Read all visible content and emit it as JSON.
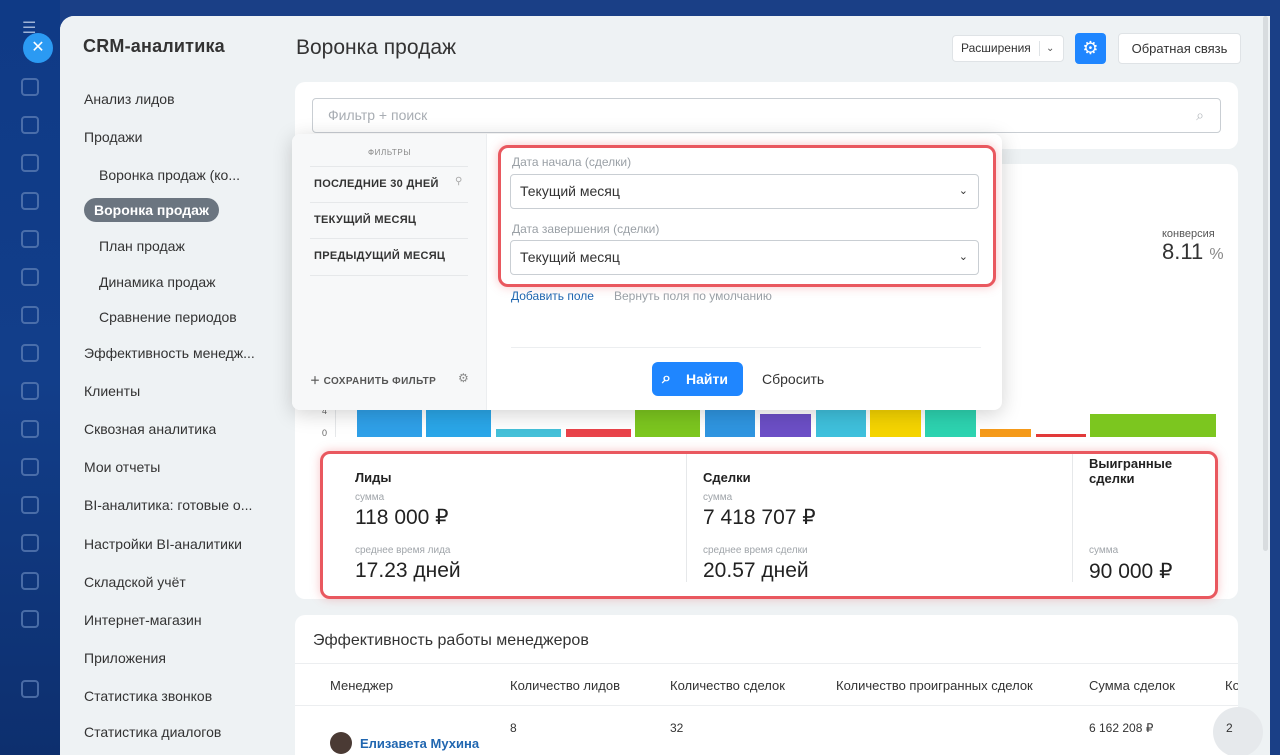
{
  "sidebar": {
    "title": "CRM-аналитика",
    "items": [
      "Анализ лидов",
      "Продажи",
      "Воронка продаж (ко...",
      "Воронка продаж",
      "План продаж",
      "Динамика продаж",
      "Сравнение периодов",
      "Эффективность менедж...",
      "Клиенты",
      "Сквозная аналитика",
      "Мои отчеты",
      "BI-аналитика: готовые о...",
      "Настройки BI-аналитики",
      "Складской учёт",
      "Интернет-магазин",
      "Приложения",
      "Статистика звонков",
      "Статистика диалогов"
    ]
  },
  "header": {
    "title": "Воронка продаж",
    "extensions_label": "Расширения",
    "feedback_label": "Обратная связь"
  },
  "search": {
    "placeholder": "Фильтр + поиск"
  },
  "filter_popup": {
    "caption": "ФИЛЬТРЫ",
    "presets": [
      "ПОСЛЕДНИЕ 30 ДНЕЙ",
      "ТЕКУЩИЙ МЕСЯЦ",
      "ПРЕДЫДУЩИЙ МЕСЯЦ"
    ],
    "save_filter": "СОХРАНИТЬ ФИЛЬТР",
    "field_start_label": "Дата начала (сделки)",
    "field_start_value": "Текущий месяц",
    "field_end_label": "Дата завершения (сделки)",
    "field_end_value": "Текущий месяц",
    "add_field": "Добавить поле",
    "restore_fields": "Вернуть поля по умолчанию",
    "find_button": "Найти",
    "reset_button": "Сбросить"
  },
  "conversion": {
    "label": "конверсия",
    "value": "8.11",
    "unit": "%"
  },
  "chart": {
    "y_axis_ticks": [
      "4",
      "0"
    ]
  },
  "stats": {
    "leads": {
      "title": "Лиды",
      "sum_label": "сумма",
      "sum": "118 000 ₽",
      "time_label": "среднее время лида",
      "time": "17.23 дней"
    },
    "deals": {
      "title": "Сделки",
      "sum_label": "сумма",
      "sum": "7 418 707 ₽",
      "time_label": "среднее время сделки",
      "time": "20.57 дней"
    },
    "won": {
      "title": "Выигранные сделки",
      "sum_label": "сумма",
      "sum": "90 000 ₽"
    }
  },
  "managers": {
    "title": "Эффективность работы менеджеров",
    "columns": [
      "Менеджер",
      "Количество лидов",
      "Количество сделок",
      "Количество проигранных сделок",
      "Сумма сделок",
      "Ко"
    ],
    "rows": [
      {
        "name": "Елизавета Мухина",
        "leads": "8",
        "deals": "32",
        "lost": "",
        "sum": "6 162 208 ₽",
        "extra": "2"
      }
    ]
  },
  "colors": {
    "accent": "#1f86ff",
    "highlight_border": "#e9585f",
    "active_menu": "#6b7580"
  }
}
